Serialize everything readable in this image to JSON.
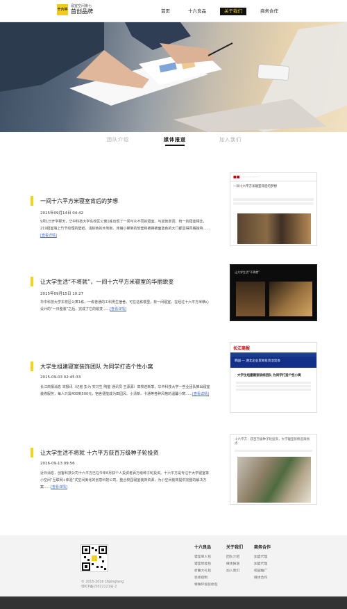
{
  "brand": {
    "sub_text": "寝室空间第七",
    "main_text": "首创品牌",
    "mark_text": "十六平"
  },
  "nav": [
    {
      "label": "首页",
      "active": false
    },
    {
      "label": "十六良品",
      "active": false
    },
    {
      "label": "关于我们",
      "active": true
    },
    {
      "label": "商务合作",
      "active": false
    }
  ],
  "subtabs": [
    {
      "label": "团队介绍",
      "active": false
    },
    {
      "label": "媒体报道",
      "active": true
    },
    {
      "label": "加入我们",
      "active": false
    }
  ],
  "articles": [
    {
      "title": "一间十六平方米寝室背后的梦想",
      "date": "2015年09月14日 04:42",
      "body": "9月1日开学那天，华中科技大学东校区公寓1栋出现了一间与众不同的寝室。与其他单调、统一的寝室相比，219寝室墙上竹节纹理的壁纸、浅棕色的木地板、床铺小梯架的软套和被褥被面蓝色的大门都显得风格独特……",
      "more": "[查看详情]",
      "thumb_caption": "一间十六平方米寝室背后的梦想"
    },
    {
      "title": "让大学生活“不将就”，一间十六平方米寝室的华丽蜕变",
      "date": "2015年09月15日 10:27",
      "body": "华中科技大学东校区公寓1栋，一栋普通的工科男生宿舍。可在这栋楼里，有一间寝室，在经过十六平方米精心设计的“一日整装”之后，完成了它的蜕变……",
      "more": "[查看详情]",
      "thumb_caption": "让大学生活“不将就”"
    },
    {
      "title": "大学生组建寝室装饰团队 为同学打造个性小窝",
      "date": "2015-09-03 02:45:33",
      "body": "长江商报消息 本报讯（记者 彭为 实习生 陶莹 通讯员 王源源）高校迎新季，华中科技大学一些业团队推出寝室装修服务，每人只需400到500元，宿舍便能成为田园风、小清新、卡通等各种风格的温馨小窝……",
      "more": "[查看详情]",
      "thumb_caption": "大学生组建寝室装修团队 为同学打造个性小窝",
      "thumb_logo": "长江商报",
      "thumb_banner": "韩国 — 湖北企业贸易投资洽谈会"
    },
    {
      "title": "让大学生活不将就 十六平方获百万级种子轮投资",
      "date": "2016-09-13 09:56",
      "body": "近日消息，创客科技公司十六平方已在今年6月获个人投资者百万级种子轮投资。十六平方是专注于大学寝室等小空间“互联网+体验”式空间美化的创意科技公司，整合校园寝室装饰资源，为小空间装饰提供完整的解决方案……",
      "more": "[查看详情]",
      "thumb_caption": "十六平方：获百万级种子轮投资，大学寝室装修迎来拐点"
    }
  ],
  "footer": {
    "copyright_line1": "© 2015-2016 16pingfang",
    "copyright_line2": "鄂ICP备15022121号-2",
    "columns": [
      {
        "heading": "十六良品",
        "links": [
          "寝室单人包",
          "寝室智能包",
          "折叠大礼包",
          "装修控制",
          "特殊环境装修包"
        ]
      },
      {
        "heading": "关于我们",
        "links": [
          "团队介绍",
          "媒体报道",
          "加入我们"
        ]
      },
      {
        "heading": "商务合作",
        "links": [
          "加盟代理",
          "加盟代理",
          "校园推广",
          "媒体合作"
        ]
      }
    ]
  },
  "colors": {
    "accent": "#f2d41a",
    "nav_active_bg": "#111111",
    "link": "#3b6ad1"
  }
}
